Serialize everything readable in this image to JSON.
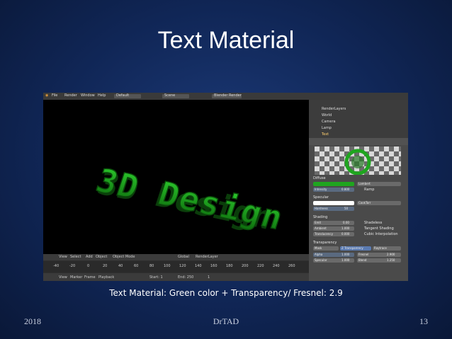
{
  "slide": {
    "title": "Text Material",
    "caption": "Text Material: Green color + Transparency/ Fresnel: 2.9",
    "footer_left": "2018",
    "footer_center": "DrTAD",
    "footer_right": "13"
  },
  "blender": {
    "menu": [
      "File",
      "Render",
      "Window",
      "Help"
    ],
    "layout": "Default",
    "scene": "Scene",
    "engine": "Blender Render",
    "viewport_text": "3D Design",
    "outliner": [
      "RenderLayers",
      "World",
      "Camera",
      "Lamp",
      "Text"
    ],
    "panels": {
      "diffuse": "Diffuse",
      "diffuse_shader": "Lambert",
      "intensity_label": "Intensity",
      "intensity_value": "0.800",
      "ramp": "Ramp",
      "specular": "Specular",
      "specular_shader": "CookTorr",
      "hardness_label": "Hardness",
      "hardness_value": "50",
      "shading": "Shading",
      "emit_label": "Emit",
      "emit_value": "0.00",
      "ambient_label": "Ambient",
      "ambient_value": "1.000",
      "translucency_label": "Translucency",
      "translucency_value": "0.000",
      "shadeless": "Shadeless",
      "tangent_shading": "Tangent Shading",
      "cubic": "Cubic Interpolation",
      "transparency": "Transparency",
      "mask": "Mask",
      "z_transparency": "Z Transparency",
      "raytrace": "Raytrace",
      "alpha_label": "Alpha",
      "alpha_value": "1.000",
      "fresnel_label": "Fresnel",
      "fresnel_value": "2.900",
      "specular_alpha_label": "Specular",
      "specular_alpha_value": "1.000",
      "blend_label": "Blend",
      "blend_value": "1.250"
    },
    "timeline": {
      "view": "View",
      "marker": "Marker",
      "frame": "Frame",
      "playback": "Playback",
      "start": "Start: 1",
      "end": "End: 250",
      "current": "1",
      "ticks": [
        "-40",
        "-20",
        "0",
        "20",
        "40",
        "60",
        "80",
        "100",
        "120",
        "140",
        "160",
        "180",
        "200",
        "220",
        "240",
        "260"
      ]
    },
    "view_header": {
      "view": "View",
      "select": "Select",
      "add": "Add",
      "object": "Object",
      "mode": "Object Mode",
      "scope": "Global",
      "render_layer": "RenderLayer"
    },
    "green": "#1fa51f",
    "green_dark": "#0b4d0b"
  }
}
